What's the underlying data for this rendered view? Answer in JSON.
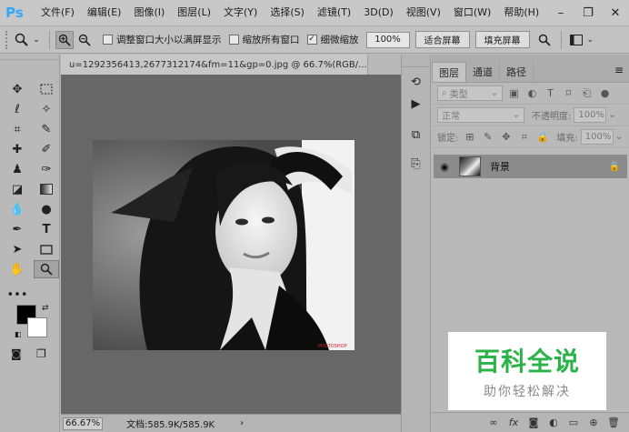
{
  "app": {
    "logo": "Ps"
  },
  "menu": [
    "文件(F)",
    "编辑(E)",
    "图像(I)",
    "图层(L)",
    "文字(Y)",
    "选择(S)",
    "滤镜(T)",
    "3D(D)",
    "视图(V)",
    "窗口(W)",
    "帮助(H)"
  ],
  "window_controls": {
    "minimize": "–",
    "restore": "❐",
    "close": "✕"
  },
  "options": {
    "tool_icon": "zoom-icon",
    "checkbox_resize": "调整窗口大小以满屏显示",
    "checkbox_resize_checked": false,
    "checkbox_all_windows": "缩放所有窗口",
    "checkbox_all_windows_checked": false,
    "checkbox_scrubby": "细微缩放",
    "checkbox_scrubby_checked": true,
    "zoom_value": "100%",
    "fit_screen": "适合屏幕",
    "fill_screen": "填充屏幕"
  },
  "document": {
    "tab_title": "u=1292356413,2677312174&fm=11&gp=0.jpg @ 66.7%(RGB/...",
    "close": "×",
    "status_zoom": "66.67%",
    "status_doc": "文档:585.9K/585.9K",
    "status_arrow": "›",
    "canvas_watermark": "PHOTOSHOP"
  },
  "layers_panel": {
    "tabs": [
      "图层",
      "通道",
      "路径"
    ],
    "active_tab": 0,
    "filter_kind": "类型",
    "blend_mode": "正常",
    "opacity_label": "不透明度:",
    "opacity_value": "100%",
    "lock_label": "锁定:",
    "fill_label": "填充:",
    "fill_value": "100%",
    "layers": [
      {
        "name": "背景",
        "visible": true,
        "locked": true
      }
    ],
    "bottom_icons": [
      "link-icon",
      "fx-icon",
      "mask-icon",
      "adjustment-icon",
      "group-icon",
      "new-layer-icon",
      "trash-icon"
    ]
  },
  "watermark": {
    "title": "百科全说",
    "subtitle": "助你轻松解决"
  }
}
